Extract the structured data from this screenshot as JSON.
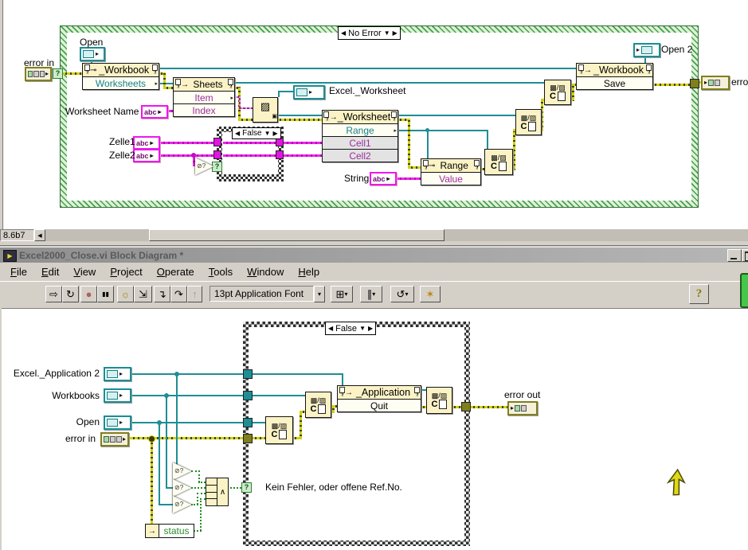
{
  "top": {
    "case_label": "No Error",
    "error_in": "error in",
    "open": "Open",
    "workbook_title": "_Workbook",
    "worksheets": "Worksheets",
    "sheets_title": "Sheets",
    "item": "Item",
    "index": "Index",
    "worksheet_name": "Worksheet Name",
    "excel_worksheet": "Excel._Worksheet",
    "inner_case": "False",
    "zelle1": "Zelle1",
    "zelle2": "Zelle2",
    "worksheet_title": "_Worksheet",
    "range_prop": "Range",
    "cell1": "Cell1",
    "cell2": "Cell2",
    "string": "String",
    "range_title": "Range",
    "value": "Value",
    "save_title": "_Workbook",
    "save": "Save",
    "open2": "Open 2",
    "error_out_clipped": "erro",
    "scroll_value": "8.6b7"
  },
  "win": {
    "title": "Excel2000_Close.vi Block Diagram *",
    "menu": [
      "File",
      "Edit",
      "View",
      "Project",
      "Operate",
      "Tools",
      "Window",
      "Help"
    ],
    "font_name": "13pt Application Font",
    "help": "?"
  },
  "bottom": {
    "case_label": "False",
    "excel_app2": "Excel._Application 2",
    "workbooks": "Workbooks",
    "open": "Open",
    "error_in": "error in",
    "app_title": "_Application",
    "quit": "Quit",
    "error_out": "error out",
    "status": "status",
    "comment": "Kein Fehler, oder offene Ref.No."
  },
  "icons": {
    "abc": "abc",
    "close_pattern": "▩/▨",
    "close_c": "C",
    "qe": "?!",
    "and_symbol": "∧",
    "question": "?",
    "not_glyph": "⊘?",
    "la": "◀",
    "ra": "▶",
    "da": "▼",
    "ras": "▸",
    "invoke": "→",
    "prop": "⊸",
    "run": "⇨",
    "run_cont": "↻",
    "abort": "●",
    "pause": "▮▮",
    "bulb": "☼",
    "retain": "⇲",
    "step_into": "↴",
    "step_over": "↷",
    "step_out": "↑",
    "align": "⊞",
    "distribute": "∥",
    "reorder": "↺",
    "cleanup": "✶",
    "dd": "▾",
    "sb_left": "◀"
  },
  "colors": {
    "teal": "#1e8e94",
    "purple": "#9b2f9f",
    "pink": "#ef16ef",
    "olive": "#7f7f1e",
    "green": "#2e8b2e"
  }
}
